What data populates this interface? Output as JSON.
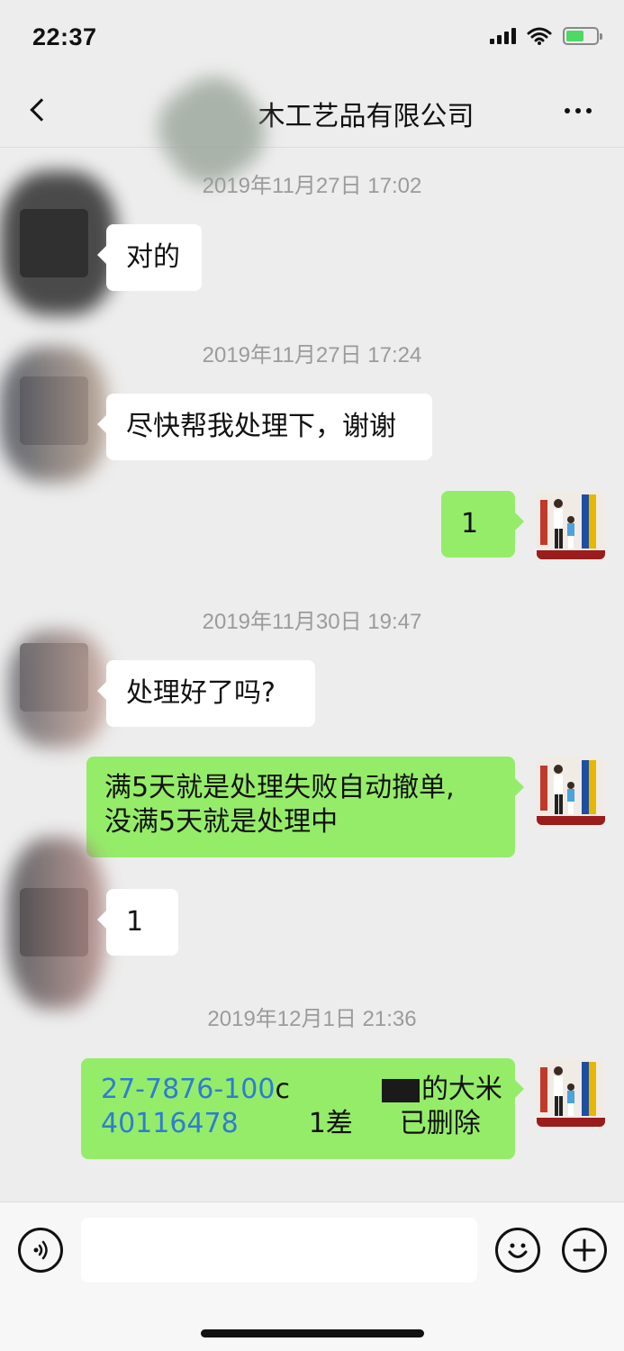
{
  "status_bar": {
    "time": "22:37"
  },
  "nav": {
    "title": "木工艺品有限公司"
  },
  "messages": [
    {
      "timestamp": "2019年11月27日 17:02"
    },
    {
      "text": "对的"
    },
    {
      "timestamp": "2019年11月27日 17:24"
    },
    {
      "text": "尽快帮我处理下，谢谢"
    },
    {
      "text": "1"
    },
    {
      "timestamp": "2019年11月30日 19:47"
    },
    {
      "text": "处理好了吗?"
    },
    {
      "line1": "满5天就是处理失败自动撤单,",
      "line2": "没满5天就是处理中"
    },
    {
      "text": "1"
    },
    {
      "timestamp": "2019年12月1日 21:36"
    },
    {
      "order_no_1": "27-7876-100",
      "order_suffix": "c",
      "product": "的大米",
      "order_no_2": "40116478",
      "diff": "1差",
      "status": "已删除"
    }
  ],
  "input": {
    "placeholder": ""
  },
  "colors": {
    "outgoing_bubble": "#95ec69",
    "incoming_bubble": "#ffffff",
    "link": "#2d7dd2",
    "background": "#ededed"
  },
  "icons": [
    "back-chevron-icon",
    "more-icon",
    "voice-icon",
    "emoji-icon",
    "add-icon",
    "wifi-icon",
    "battery-icon",
    "signal-icon"
  ]
}
